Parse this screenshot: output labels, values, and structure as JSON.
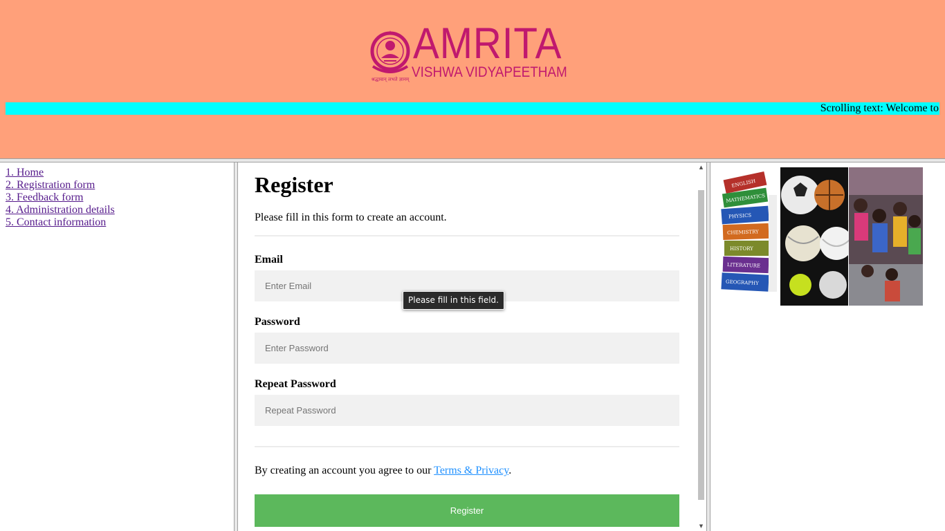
{
  "header": {
    "logo": {
      "name": "AMRITA",
      "subtitle": "VISHWA VIDYAPEETHAM",
      "tagline": "श्रद्धावान् लभते ज्ञानम्"
    },
    "marquee_text": "Scrolling text: Welcome to",
    "background_color": "#ffa07a",
    "marquee_color": "#00ffff"
  },
  "nav": {
    "items": [
      {
        "label": "1. Home"
      },
      {
        "label": "2. Registration form"
      },
      {
        "label": "3. Feedback form"
      },
      {
        "label": "4. Administration details"
      },
      {
        "label": "5. Contact information"
      }
    ]
  },
  "form": {
    "title": "Register",
    "intro": "Please fill in this form to create an account.",
    "email": {
      "label": "Email",
      "placeholder": "Enter Email",
      "value": ""
    },
    "password": {
      "label": "Password",
      "placeholder": "Enter Password",
      "value": ""
    },
    "repeat_password": {
      "label": "Repeat Password",
      "placeholder": "Repeat Password",
      "value": ""
    },
    "terms_prefix": "By creating an account you agree to our ",
    "terms_link": "Terms & Privacy",
    "terms_suffix": ".",
    "submit_label": "Register",
    "validation_tooltip": "Please fill in this field.",
    "button_color": "#5cb85c",
    "link_color": "#1e90ff"
  },
  "aside": {
    "image_icons": [
      "books-stack-icon",
      "sports-balls-icon",
      "students-group-icon"
    ],
    "book_spines": [
      "ENGLISH",
      "MATHEMATICS",
      "PHYSICS",
      "CHEMISTRY",
      "HISTORY",
      "LITERATURE",
      "GEOGRAPHY"
    ]
  }
}
